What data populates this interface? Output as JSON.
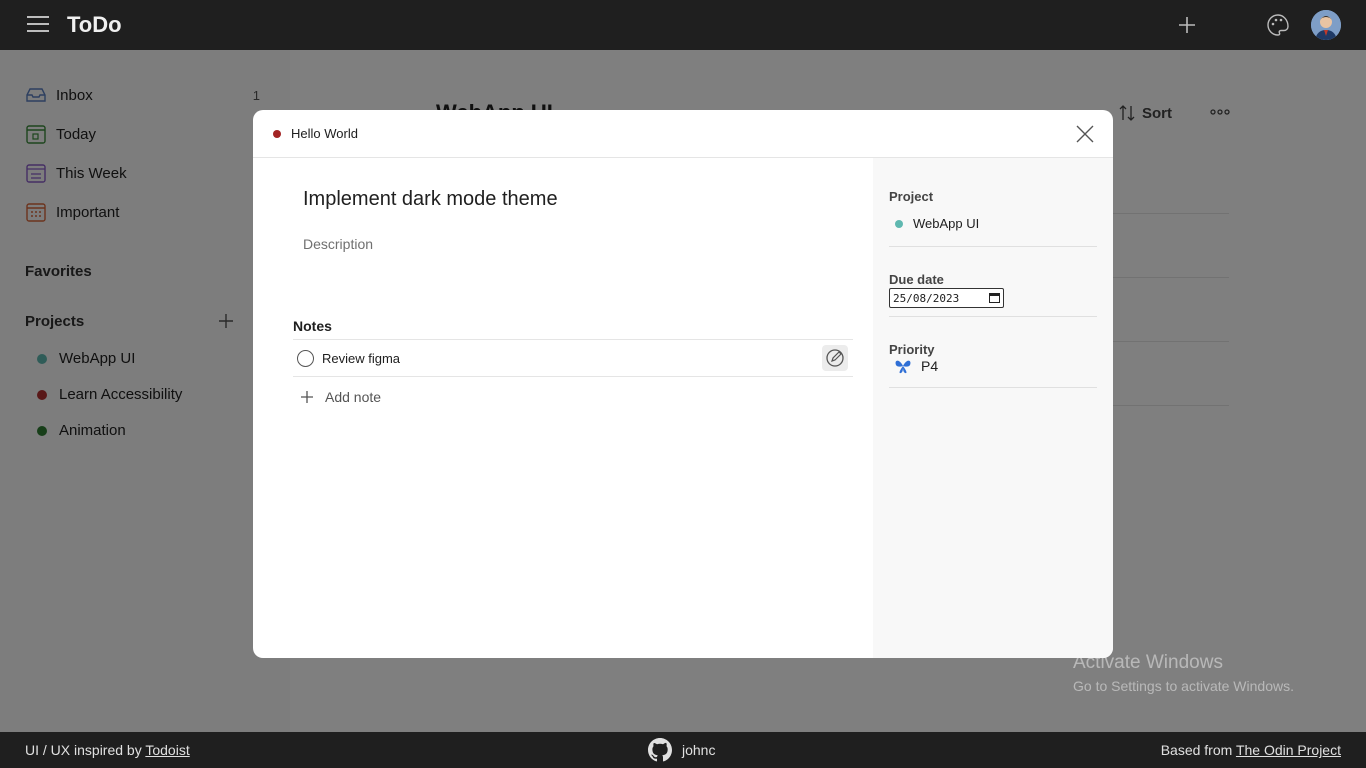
{
  "app": {
    "title": "ToDo"
  },
  "header": {
    "icons": [
      "menu-icon",
      "plus-icon",
      "palette-icon",
      "avatar"
    ]
  },
  "sidebar": {
    "nav": [
      {
        "label": "Inbox",
        "count": "1",
        "icon": "inbox-icon"
      },
      {
        "label": "Today",
        "icon": "calendar-today-icon"
      },
      {
        "label": "This Week",
        "icon": "calendar-week-icon"
      },
      {
        "label": "Important",
        "icon": "calendar-important-icon"
      }
    ],
    "favorites_title": "Favorites",
    "projects_title": "Projects",
    "projects": [
      {
        "label": "WebApp UI",
        "color": "#5fb8b0"
      },
      {
        "label": "Learn Accessibility",
        "color": "#b23030"
      },
      {
        "label": "Animation",
        "color": "#2e7d32"
      }
    ]
  },
  "main": {
    "title": "WebApp UI",
    "sort_label": "Sort"
  },
  "modal": {
    "project_label": "Hello World",
    "project_color": "#a32424",
    "task_title": "Implement dark mode theme",
    "description_placeholder": "Description",
    "notes_title": "Notes",
    "notes": [
      {
        "text": "Review figma"
      }
    ],
    "add_note_label": "Add note",
    "side": {
      "project_title": "Project",
      "project_value": "WebApp UI",
      "project_color": "#5fb8b0",
      "due_title": "Due date",
      "due_value": "25/08/2023",
      "priority_title": "Priority",
      "priority_value": "P4",
      "priority_color": "#2f6fd6"
    }
  },
  "footer": {
    "left_prefix": "UI / UX inspired by ",
    "left_link": "Todoist",
    "github_user": "johnc",
    "right_prefix": "Based from ",
    "right_link": "The Odin Project"
  },
  "watermark": {
    "line1": "Activate Windows",
    "line2": "Go to Settings to activate Windows."
  }
}
